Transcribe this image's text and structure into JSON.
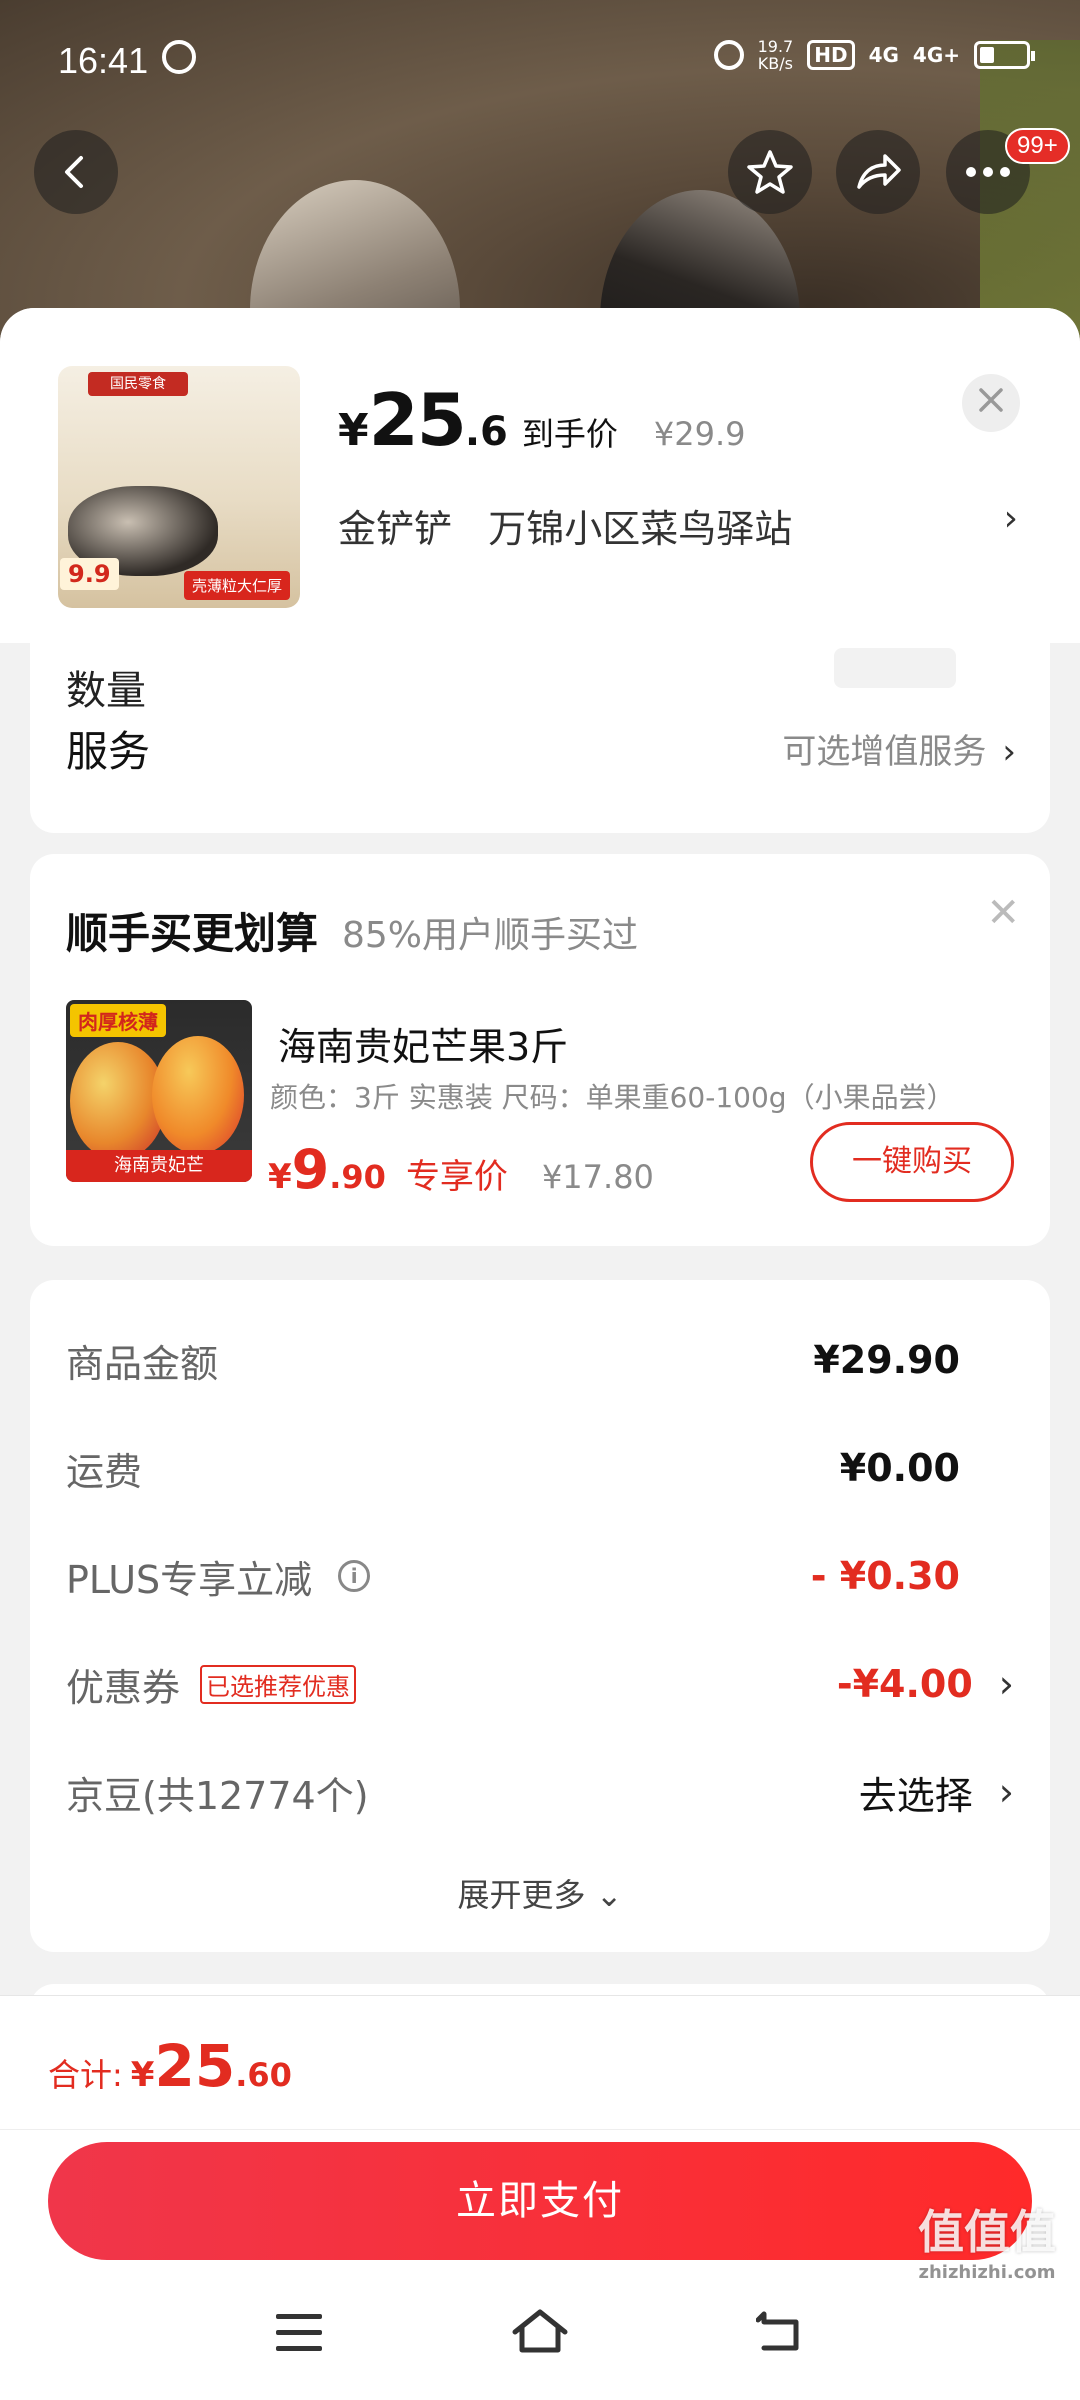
{
  "status": {
    "time": "16:41",
    "net_speed": "19.7",
    "net_unit": "KB/s",
    "hd": "HD",
    "signal1": "4G",
    "signal2": "4G+"
  },
  "nav": {
    "badge": "99+"
  },
  "product": {
    "yen": "¥",
    "price_int": "25",
    "price_dec": ".6",
    "price_label": "到手价",
    "orig_price": "¥29.9",
    "thumb_price": "9.9",
    "thumb_tag": "壳薄粒大仁厚",
    "thumb_banner": "国民零食",
    "address_name": "金铲铲",
    "address_place": "万锦小区菜鸟驿站"
  },
  "service": {
    "label": "服务",
    "value": "可选增值服务",
    "partial_label": "数量"
  },
  "upsell": {
    "title": "顺手买更划算",
    "subtitle": "85%用户顺手买过",
    "item": {
      "tag": "肉厚核薄",
      "image_label": "海南贵妃芒",
      "name": "海南贵妃芒果3斤",
      "spec": "颜色：3斤 实惠装  尺码：单果重60-100g（小果品尝）",
      "yen": "¥",
      "price_int": "9",
      "price_dec": ".90",
      "price_label": "专享价",
      "orig_price": "¥17.80",
      "buy_label": "一键购买"
    }
  },
  "summary": {
    "rows": [
      {
        "label": "商品金额",
        "value": "¥29.90"
      },
      {
        "label": "运费",
        "value": "¥0.00"
      },
      {
        "label": "PLUS专享立减",
        "value": "- ¥0.30"
      },
      {
        "label": "优惠券",
        "tag": "已选推荐优惠",
        "value": "-¥4.00"
      },
      {
        "label": "京豆(共12774个)",
        "value": "去选择"
      }
    ],
    "expand": "展开更多"
  },
  "footer": {
    "total_label": "合计:",
    "yen": "¥",
    "total_int": "25",
    "total_dec": ".60",
    "pay_label": "立即支付"
  },
  "watermark": {
    "text": "值值值",
    "sub": "zhizhizhi.com"
  },
  "colors": {
    "accent": "#e22c20",
    "pay_button": "#ff2a2a"
  }
}
